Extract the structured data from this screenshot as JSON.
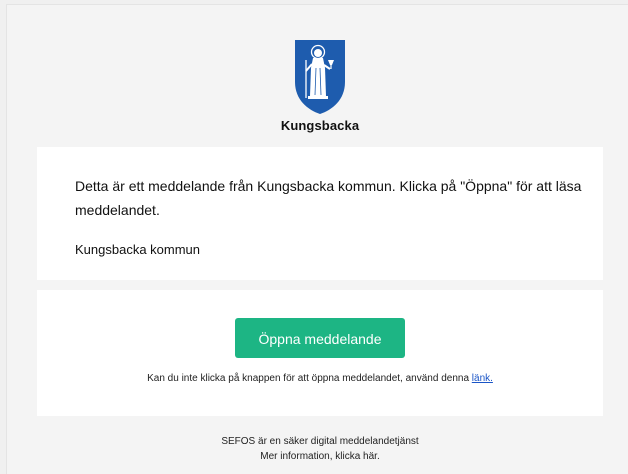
{
  "header": {
    "logo_icon": "kungsbacka-coat-of-arms-icon",
    "logo_text": "Kungsbacka",
    "brand_color": "#1e5cae"
  },
  "message": {
    "body": "Detta är ett meddelande från Kungsbacka kommun. Klicka på \"Öppna\" för att läsa meddelandet.",
    "sender": "Kungsbacka kommun"
  },
  "action": {
    "open_button_label": "Öppna meddelande",
    "open_button_color": "#1db584",
    "help_text": "Kan du inte klicka på knappen för att öppna meddelandet, använd denna ",
    "help_link_label": "länk."
  },
  "footer": {
    "line1": "SEFOS är en säker digital meddelandetjänst",
    "line2": "Mer information, klicka här."
  }
}
